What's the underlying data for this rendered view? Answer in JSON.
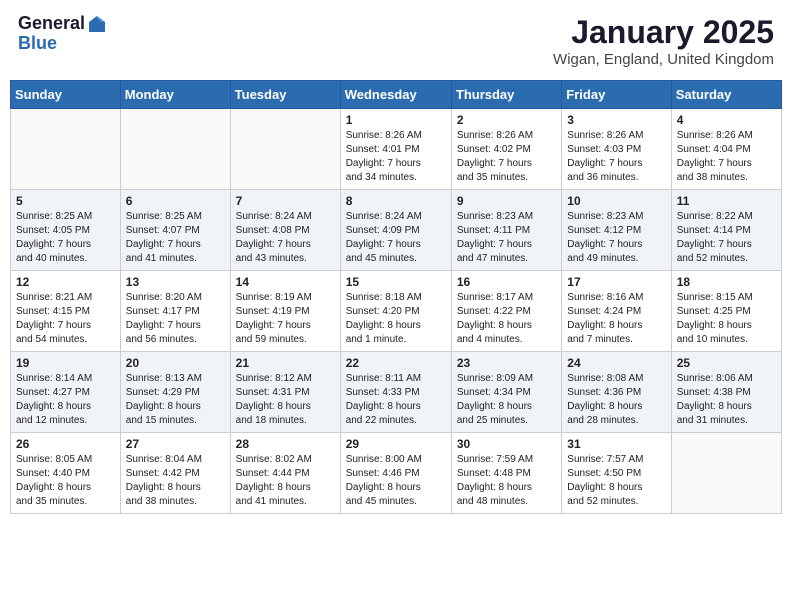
{
  "header": {
    "logo_general": "General",
    "logo_blue": "Blue",
    "month": "January 2025",
    "location": "Wigan, England, United Kingdom"
  },
  "weekdays": [
    "Sunday",
    "Monday",
    "Tuesday",
    "Wednesday",
    "Thursday",
    "Friday",
    "Saturday"
  ],
  "weeks": [
    [
      {
        "day": "",
        "content": ""
      },
      {
        "day": "",
        "content": ""
      },
      {
        "day": "",
        "content": ""
      },
      {
        "day": "1",
        "content": "Sunrise: 8:26 AM\nSunset: 4:01 PM\nDaylight: 7 hours\nand 34 minutes."
      },
      {
        "day": "2",
        "content": "Sunrise: 8:26 AM\nSunset: 4:02 PM\nDaylight: 7 hours\nand 35 minutes."
      },
      {
        "day": "3",
        "content": "Sunrise: 8:26 AM\nSunset: 4:03 PM\nDaylight: 7 hours\nand 36 minutes."
      },
      {
        "day": "4",
        "content": "Sunrise: 8:26 AM\nSunset: 4:04 PM\nDaylight: 7 hours\nand 38 minutes."
      }
    ],
    [
      {
        "day": "5",
        "content": "Sunrise: 8:25 AM\nSunset: 4:05 PM\nDaylight: 7 hours\nand 40 minutes."
      },
      {
        "day": "6",
        "content": "Sunrise: 8:25 AM\nSunset: 4:07 PM\nDaylight: 7 hours\nand 41 minutes."
      },
      {
        "day": "7",
        "content": "Sunrise: 8:24 AM\nSunset: 4:08 PM\nDaylight: 7 hours\nand 43 minutes."
      },
      {
        "day": "8",
        "content": "Sunrise: 8:24 AM\nSunset: 4:09 PM\nDaylight: 7 hours\nand 45 minutes."
      },
      {
        "day": "9",
        "content": "Sunrise: 8:23 AM\nSunset: 4:11 PM\nDaylight: 7 hours\nand 47 minutes."
      },
      {
        "day": "10",
        "content": "Sunrise: 8:23 AM\nSunset: 4:12 PM\nDaylight: 7 hours\nand 49 minutes."
      },
      {
        "day": "11",
        "content": "Sunrise: 8:22 AM\nSunset: 4:14 PM\nDaylight: 7 hours\nand 52 minutes."
      }
    ],
    [
      {
        "day": "12",
        "content": "Sunrise: 8:21 AM\nSunset: 4:15 PM\nDaylight: 7 hours\nand 54 minutes."
      },
      {
        "day": "13",
        "content": "Sunrise: 8:20 AM\nSunset: 4:17 PM\nDaylight: 7 hours\nand 56 minutes."
      },
      {
        "day": "14",
        "content": "Sunrise: 8:19 AM\nSunset: 4:19 PM\nDaylight: 7 hours\nand 59 minutes."
      },
      {
        "day": "15",
        "content": "Sunrise: 8:18 AM\nSunset: 4:20 PM\nDaylight: 8 hours\nand 1 minute."
      },
      {
        "day": "16",
        "content": "Sunrise: 8:17 AM\nSunset: 4:22 PM\nDaylight: 8 hours\nand 4 minutes."
      },
      {
        "day": "17",
        "content": "Sunrise: 8:16 AM\nSunset: 4:24 PM\nDaylight: 8 hours\nand 7 minutes."
      },
      {
        "day": "18",
        "content": "Sunrise: 8:15 AM\nSunset: 4:25 PM\nDaylight: 8 hours\nand 10 minutes."
      }
    ],
    [
      {
        "day": "19",
        "content": "Sunrise: 8:14 AM\nSunset: 4:27 PM\nDaylight: 8 hours\nand 12 minutes."
      },
      {
        "day": "20",
        "content": "Sunrise: 8:13 AM\nSunset: 4:29 PM\nDaylight: 8 hours\nand 15 minutes."
      },
      {
        "day": "21",
        "content": "Sunrise: 8:12 AM\nSunset: 4:31 PM\nDaylight: 8 hours\nand 18 minutes."
      },
      {
        "day": "22",
        "content": "Sunrise: 8:11 AM\nSunset: 4:33 PM\nDaylight: 8 hours\nand 22 minutes."
      },
      {
        "day": "23",
        "content": "Sunrise: 8:09 AM\nSunset: 4:34 PM\nDaylight: 8 hours\nand 25 minutes."
      },
      {
        "day": "24",
        "content": "Sunrise: 8:08 AM\nSunset: 4:36 PM\nDaylight: 8 hours\nand 28 minutes."
      },
      {
        "day": "25",
        "content": "Sunrise: 8:06 AM\nSunset: 4:38 PM\nDaylight: 8 hours\nand 31 minutes."
      }
    ],
    [
      {
        "day": "26",
        "content": "Sunrise: 8:05 AM\nSunset: 4:40 PM\nDaylight: 8 hours\nand 35 minutes."
      },
      {
        "day": "27",
        "content": "Sunrise: 8:04 AM\nSunset: 4:42 PM\nDaylight: 8 hours\nand 38 minutes."
      },
      {
        "day": "28",
        "content": "Sunrise: 8:02 AM\nSunset: 4:44 PM\nDaylight: 8 hours\nand 41 minutes."
      },
      {
        "day": "29",
        "content": "Sunrise: 8:00 AM\nSunset: 4:46 PM\nDaylight: 8 hours\nand 45 minutes."
      },
      {
        "day": "30",
        "content": "Sunrise: 7:59 AM\nSunset: 4:48 PM\nDaylight: 8 hours\nand 48 minutes."
      },
      {
        "day": "31",
        "content": "Sunrise: 7:57 AM\nSunset: 4:50 PM\nDaylight: 8 hours\nand 52 minutes."
      },
      {
        "day": "",
        "content": ""
      }
    ]
  ]
}
